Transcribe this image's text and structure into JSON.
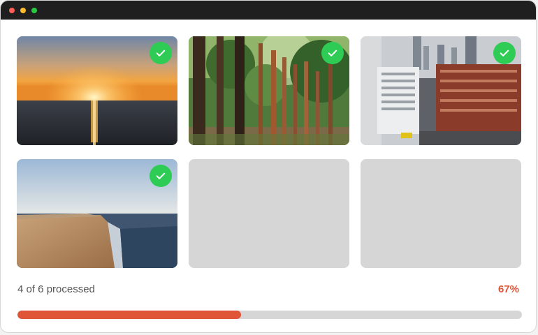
{
  "colors": {
    "accent": "#e05437",
    "check": "#2ecc55",
    "placeholder": "#d6d6d6",
    "titlebar": "#1f1f1f"
  },
  "gallery": {
    "items": [
      {
        "subject": "sunset over sea",
        "processed": true
      },
      {
        "subject": "forest path",
        "processed": true
      },
      {
        "subject": "city street",
        "processed": true
      },
      {
        "subject": "beach shoreline",
        "processed": true
      },
      {
        "subject": "placeholder",
        "processed": false
      },
      {
        "subject": "placeholder",
        "processed": false
      }
    ]
  },
  "status": {
    "label": "4 of 6 processed",
    "percent_label": "67%",
    "progress_fraction": 0.443
  },
  "icons": {
    "check": "check-icon"
  }
}
